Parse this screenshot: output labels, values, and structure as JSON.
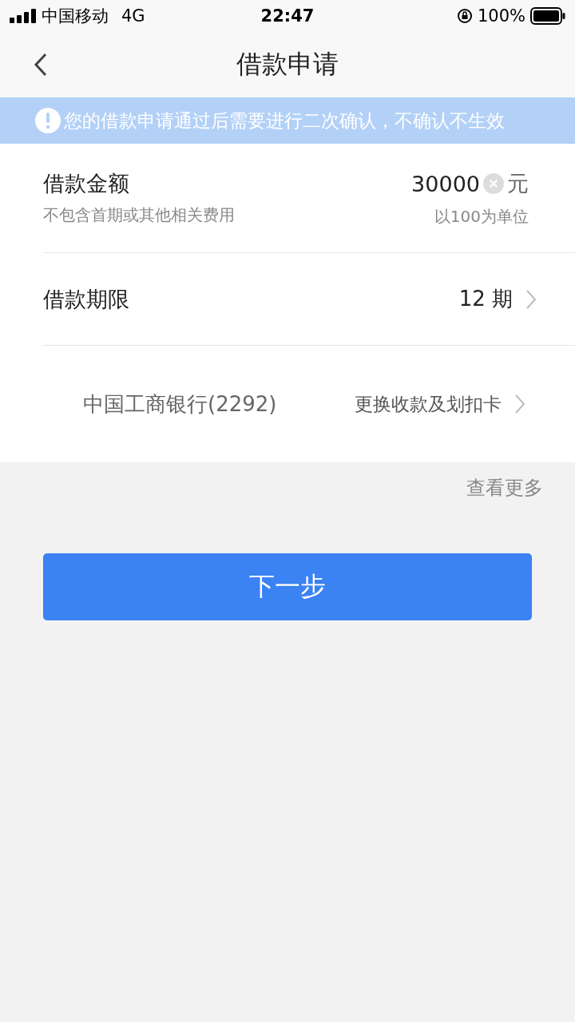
{
  "status_bar": {
    "carrier": "中国移动",
    "network": "4G",
    "time": "22:47",
    "battery": "100%"
  },
  "nav": {
    "title": "借款申请"
  },
  "notice": {
    "text": "您的借款申请通过后需要进行二次确认，不确认不生效"
  },
  "amount": {
    "label": "借款金额",
    "hint": "不包含首期或其他相关费用",
    "value": "30000",
    "unit": "元",
    "note": "以100为单位"
  },
  "term": {
    "label": "借款期限",
    "value": "12 期"
  },
  "card": {
    "bank": "中国工商银行(2292)",
    "action": "更换收款及划扣卡"
  },
  "more_link": "查看更多",
  "next_button": "下一步"
}
